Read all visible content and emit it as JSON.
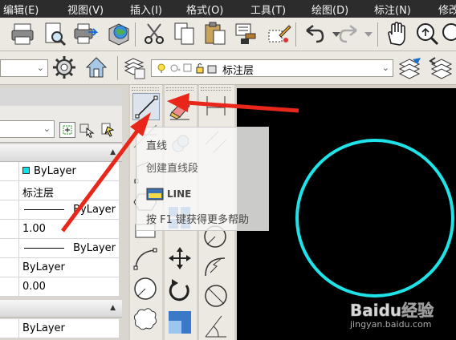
{
  "menu": [
    "编辑(E)",
    "视图(V)",
    "插入(I)",
    "格式(O)",
    "工具(T)",
    "绘图(D)",
    "标注(N)",
    "修改"
  ],
  "layer": {
    "current": "标注层"
  },
  "properties": {
    "rows": [
      {
        "name": "color",
        "value": "ByLayer",
        "swatch": "#00e5e5"
      },
      {
        "name": "layer",
        "value": "标注层"
      },
      {
        "name": "linetype",
        "value": "ByLayer"
      },
      {
        "name": "linetype-scale",
        "value": "1.00"
      },
      {
        "name": "lineweight",
        "value": "ByLayer"
      },
      {
        "name": "plot-style",
        "value": "ByLayer"
      },
      {
        "name": "thickness",
        "value": "0.00"
      },
      {
        "name": "bottom",
        "value": "ByLayer"
      }
    ]
  },
  "tooltip": {
    "title": "直线",
    "description": "创建直线段",
    "command": "LINE",
    "help": "按 F1 键获得更多帮助"
  },
  "watermark": {
    "logo": "Baidu经验",
    "sub": "jingyan.baidu.com"
  },
  "colors": {
    "circle": "#1ee3e8",
    "arrow": "#e8261a",
    "canvas": "#000000"
  }
}
